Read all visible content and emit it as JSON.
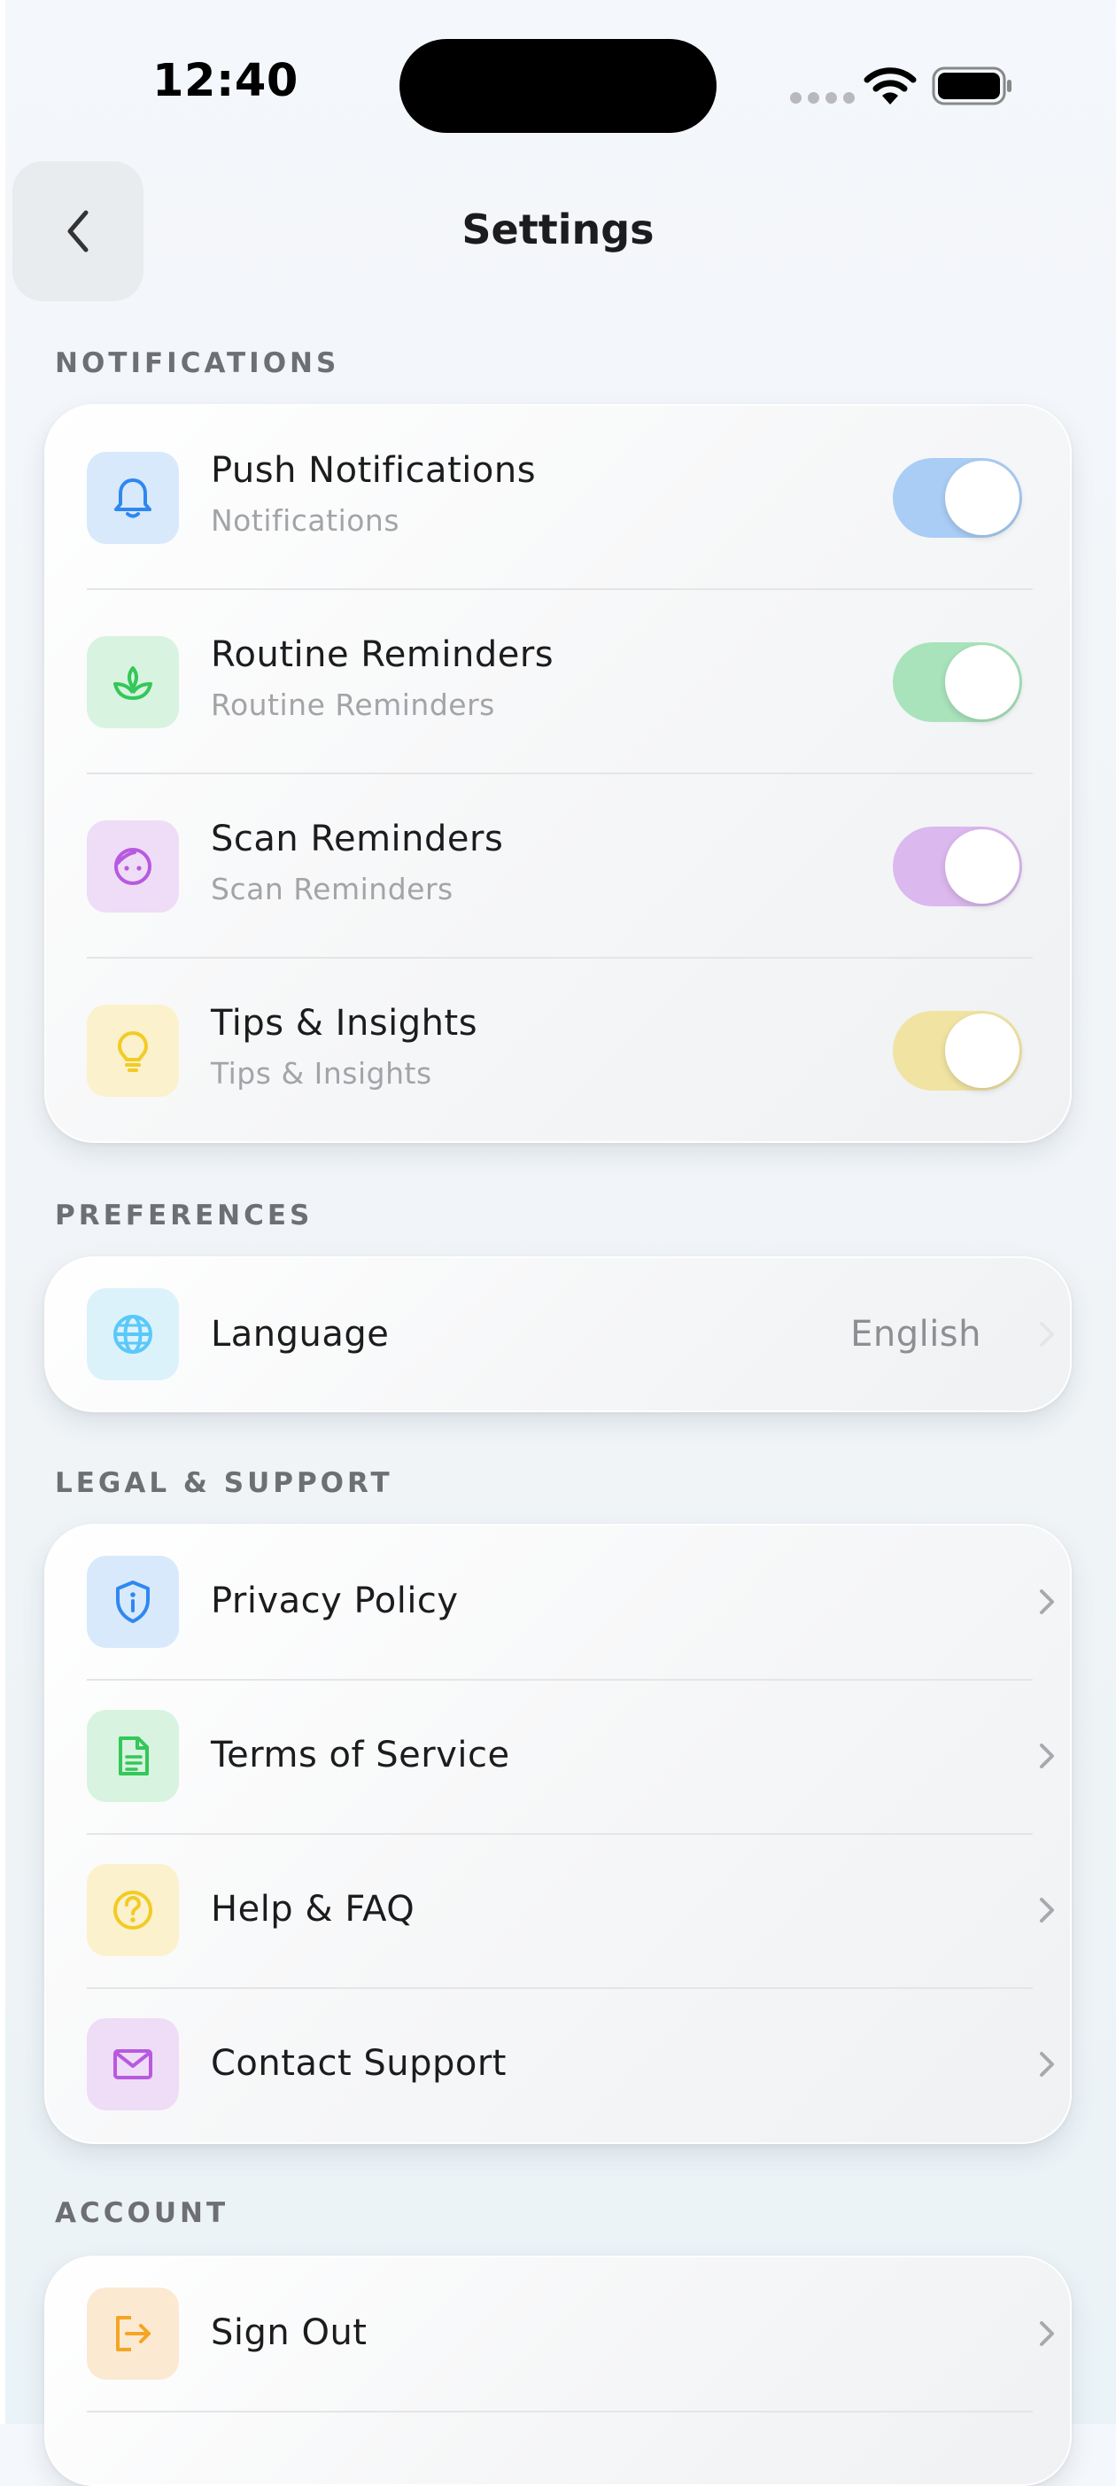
{
  "status_bar": {
    "time": "12:40"
  },
  "header": {
    "title": "Settings"
  },
  "sections": {
    "notifications": {
      "label": "NOTIFICATIONS",
      "items": [
        {
          "title": "Push Notifications",
          "subtitle": "Notifications",
          "icon": "bell-icon",
          "enabled": true,
          "accent": "#2f88f0",
          "tile": "#d8e9fc",
          "track": "#a9cdf5"
        },
        {
          "title": "Routine Reminders",
          "subtitle": "Routine Reminders",
          "icon": "sprout-icon",
          "enabled": true,
          "accent": "#34c759",
          "tile": "#d8f3df",
          "track": "#a8e3bb"
        },
        {
          "title": "Scan Reminders",
          "subtitle": "Scan Reminders",
          "icon": "face-icon",
          "enabled": true,
          "accent": "#b75ae0",
          "tile": "#efdcf6",
          "track": "#dbb8ee"
        },
        {
          "title": "Tips & Insights",
          "subtitle": "Tips & Insights",
          "icon": "lightbulb-icon",
          "enabled": true,
          "accent": "#f2cb24",
          "tile": "#fbf1cc",
          "track": "#f1e3a2"
        }
      ]
    },
    "preferences": {
      "label": "PREFERENCES",
      "items": [
        {
          "title": "Language",
          "value": "English",
          "icon": "globe-icon",
          "accent": "#5ac8fa",
          "tile": "#dcf2fb"
        }
      ]
    },
    "legal": {
      "label": "LEGAL & SUPPORT",
      "items": [
        {
          "title": "Privacy Policy",
          "icon": "shield-info-icon",
          "accent": "#2f88f0",
          "tile": "#d8e9fc"
        },
        {
          "title": "Terms of Service",
          "icon": "document-icon",
          "accent": "#34c759",
          "tile": "#d8f3df"
        },
        {
          "title": "Help & FAQ",
          "icon": "question-icon",
          "accent": "#f2cb24",
          "tile": "#fbf1cc"
        },
        {
          "title": "Contact Support",
          "icon": "mail-icon",
          "accent": "#b75ae0",
          "tile": "#efdcf6"
        }
      ]
    },
    "account": {
      "label": "ACCOUNT",
      "items": [
        {
          "title": "Sign Out",
          "icon": "sign-out-icon",
          "accent": "#f5a524",
          "tile": "#fce9d2"
        }
      ]
    }
  }
}
